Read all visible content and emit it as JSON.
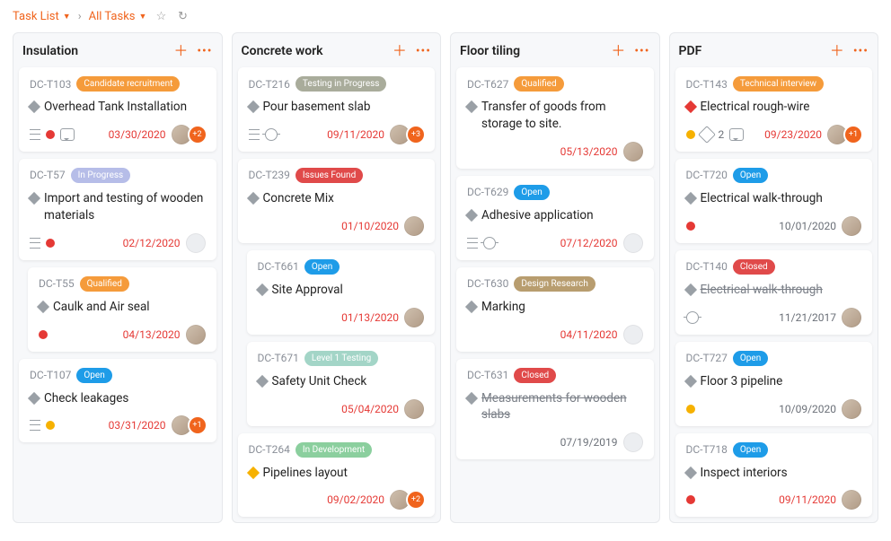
{
  "breadcrumb": {
    "root": "Task List",
    "current": "All Tasks"
  },
  "status_styles": {
    "Candidate recruitment": "#f59b3b",
    "In Progress": "#b6bde8",
    "Qualified": "#f59b3b",
    "Open": "#1e9ce8",
    "Testing in Progress": "#a9ac9b",
    "Issues Found": "#e04a4a",
    "Level 1 Testing": "#a3d5c7",
    "In Development": "#8bcf9e",
    "Design Research": "#b89d6f",
    "Closed": "#e04a4a",
    "Technical interview": "#f59b3b"
  },
  "priority_colors": {
    "gray": "#9aa0a6",
    "red": "#e53935",
    "yellow": "#f6b100"
  },
  "columns": [
    {
      "title": "Insulation",
      "cards": [
        {
          "id": "DC-T103",
          "status": "Candidate recruitment",
          "priority": "gray",
          "title": "Overhead Tank Installation",
          "icons": [
            "stack",
            "dot-red",
            "chat"
          ],
          "date": "03/30/2020",
          "date_red": true,
          "avatar": "filled",
          "overflow": "+2"
        },
        {
          "id": "DC-T57",
          "status": "In Progress",
          "priority": "gray",
          "title": "Import and testing of wooden materials",
          "icons": [
            "stack",
            "dot-red"
          ],
          "date": "02/12/2020",
          "date_red": true,
          "avatar": "empty"
        },
        {
          "id": "DC-T55",
          "status": "Qualified",
          "priority": "gray",
          "indent": true,
          "title": "Caulk and Air seal",
          "icons": [
            "dot-red"
          ],
          "date": "04/13/2020",
          "date_red": true,
          "avatar": "filled"
        },
        {
          "id": "DC-T107",
          "status": "Open",
          "priority": "gray",
          "title": "Check leakages",
          "icons": [
            "stack",
            "dot-amber"
          ],
          "date": "03/31/2020",
          "date_red": true,
          "avatar": "filled",
          "overflow": "+1"
        }
      ]
    },
    {
      "title": "Concrete work",
      "cards": [
        {
          "id": "DC-T216",
          "status": "Testing in Progress",
          "priority": "gray",
          "title": "Pour basement slab",
          "icons": [
            "stack",
            "bug"
          ],
          "date": "09/11/2020",
          "date_red": true,
          "avatar": "filled",
          "overflow": "+3"
        },
        {
          "id": "DC-T239",
          "status": "Issues Found",
          "priority": "gray",
          "title": "Concrete Mix",
          "icons": [],
          "date": "01/10/2020",
          "date_red": true,
          "avatar": "filled"
        },
        {
          "id": "DC-T661",
          "status": "Open",
          "priority": "gray",
          "indent": true,
          "title": "Site Approval",
          "icons": [],
          "date": "01/13/2020",
          "date_red": true,
          "avatar": "filled"
        },
        {
          "id": "DC-T671",
          "status": "Level 1 Testing",
          "priority": "gray",
          "indent": true,
          "title": "Safety Unit Check",
          "icons": [],
          "date": "05/04/2020",
          "date_red": true,
          "avatar": "filled"
        },
        {
          "id": "DC-T264",
          "status": "In Development",
          "priority": "yellow",
          "title": "Pipelines layout",
          "icons": [],
          "date": "09/02/2020",
          "date_red": true,
          "avatar": "filled",
          "overflow": "+2"
        }
      ]
    },
    {
      "title": "Floor tiling",
      "cards": [
        {
          "id": "DC-T627",
          "status": "Qualified",
          "priority": "gray",
          "title": "Transfer of goods from storage to site.",
          "icons": [],
          "date": "05/13/2020",
          "date_red": true,
          "avatar": "filled"
        },
        {
          "id": "DC-T629",
          "status": "Open",
          "priority": "gray",
          "title": "Adhesive application",
          "icons": [
            "stack",
            "bug"
          ],
          "date": "07/12/2020",
          "date_red": true,
          "avatar": "empty"
        },
        {
          "id": "DC-T630",
          "status": "Design Research",
          "priority": "gray",
          "title": "Marking",
          "icons": [],
          "date": "04/11/2020",
          "date_red": true,
          "avatar": "empty"
        },
        {
          "id": "DC-T631",
          "status": "Closed",
          "priority": "gray",
          "closed": true,
          "title": "Measurements for wooden slabs",
          "icons": [],
          "date": "07/19/2019",
          "date_red": false,
          "avatar": "empty"
        }
      ]
    },
    {
      "title": "PDF",
      "cards": [
        {
          "id": "DC-T143",
          "status": "Technical interview",
          "priority": "red",
          "title": "Electrical rough-wire",
          "icons": [
            "dot-amber",
            "tag",
            "2",
            "chat"
          ],
          "date": "09/23/2020",
          "date_red": true,
          "avatar": "filled",
          "overflow": "+1"
        },
        {
          "id": "DC-T720",
          "status": "Open",
          "priority": "gray",
          "title": "Electrical walk-through",
          "icons": [
            "dot-red"
          ],
          "date": "10/01/2020",
          "date_red": false,
          "avatar": "filled"
        },
        {
          "id": "DC-T140",
          "status": "Closed",
          "priority": "gray",
          "closed": true,
          "title": "Electrical walk-through",
          "icons": [
            "bug"
          ],
          "date": "11/21/2017",
          "date_red": false,
          "avatar": "filled"
        },
        {
          "id": "DC-T727",
          "status": "Open",
          "priority": "gray",
          "title": "Floor 3 pipeline",
          "icons": [
            "dot-amber"
          ],
          "date": "10/09/2020",
          "date_red": false,
          "avatar": "filled"
        },
        {
          "id": "DC-T718",
          "status": "Open",
          "priority": "gray",
          "title": "Inspect interiors",
          "icons": [
            "dot-red"
          ],
          "date": "09/11/2020",
          "date_red": true,
          "avatar": "filled"
        }
      ]
    }
  ]
}
